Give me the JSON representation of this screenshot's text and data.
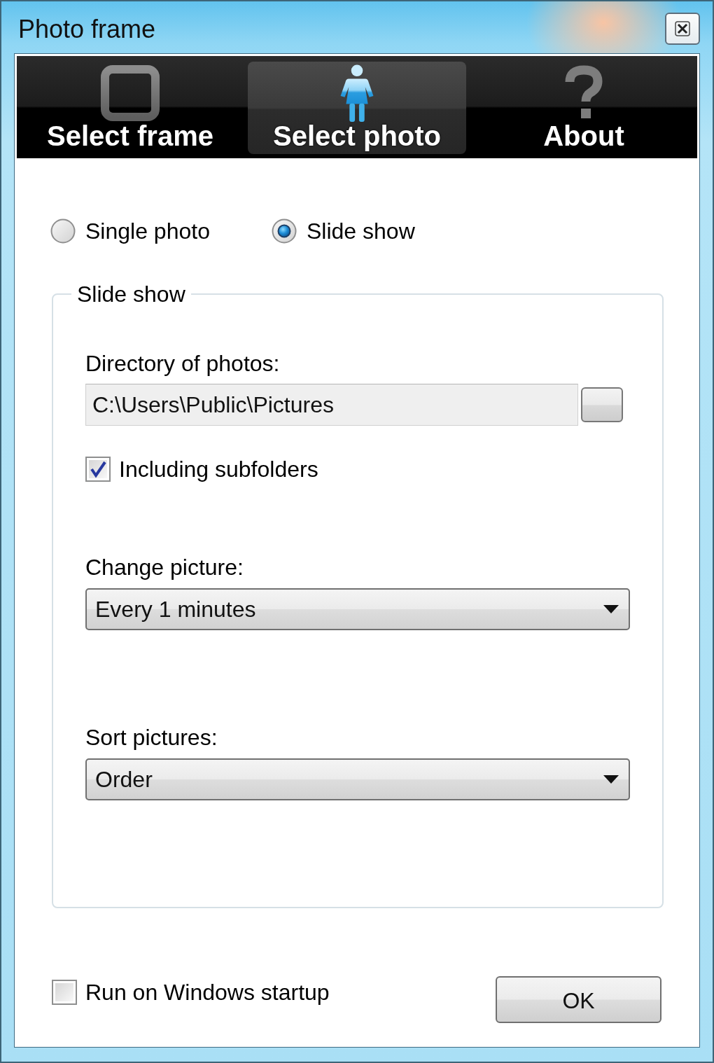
{
  "window": {
    "title": "Photo frame"
  },
  "tabs": [
    {
      "label": "Select frame",
      "selected": false
    },
    {
      "label": "Select photo",
      "selected": true
    },
    {
      "label": "About",
      "selected": false
    }
  ],
  "mode_options": [
    {
      "label": "Single photo",
      "selected": false
    },
    {
      "label": "Slide show",
      "selected": true
    }
  ],
  "slide_show": {
    "title": "Slide show",
    "directory": {
      "label": "Directory of photos:",
      "value": "C:\\Users\\Public\\Pictures"
    },
    "include_subfolders": {
      "label": "Including subfolders",
      "checked": true
    },
    "change_picture": {
      "label": "Change picture:",
      "value": "Every 1 minutes"
    },
    "sort_pictures": {
      "label": "Sort pictures:",
      "value": "Order"
    }
  },
  "run_on_startup": {
    "label": "Run on Windows startup",
    "checked": false
  },
  "ok_button": {
    "label": "OK"
  }
}
